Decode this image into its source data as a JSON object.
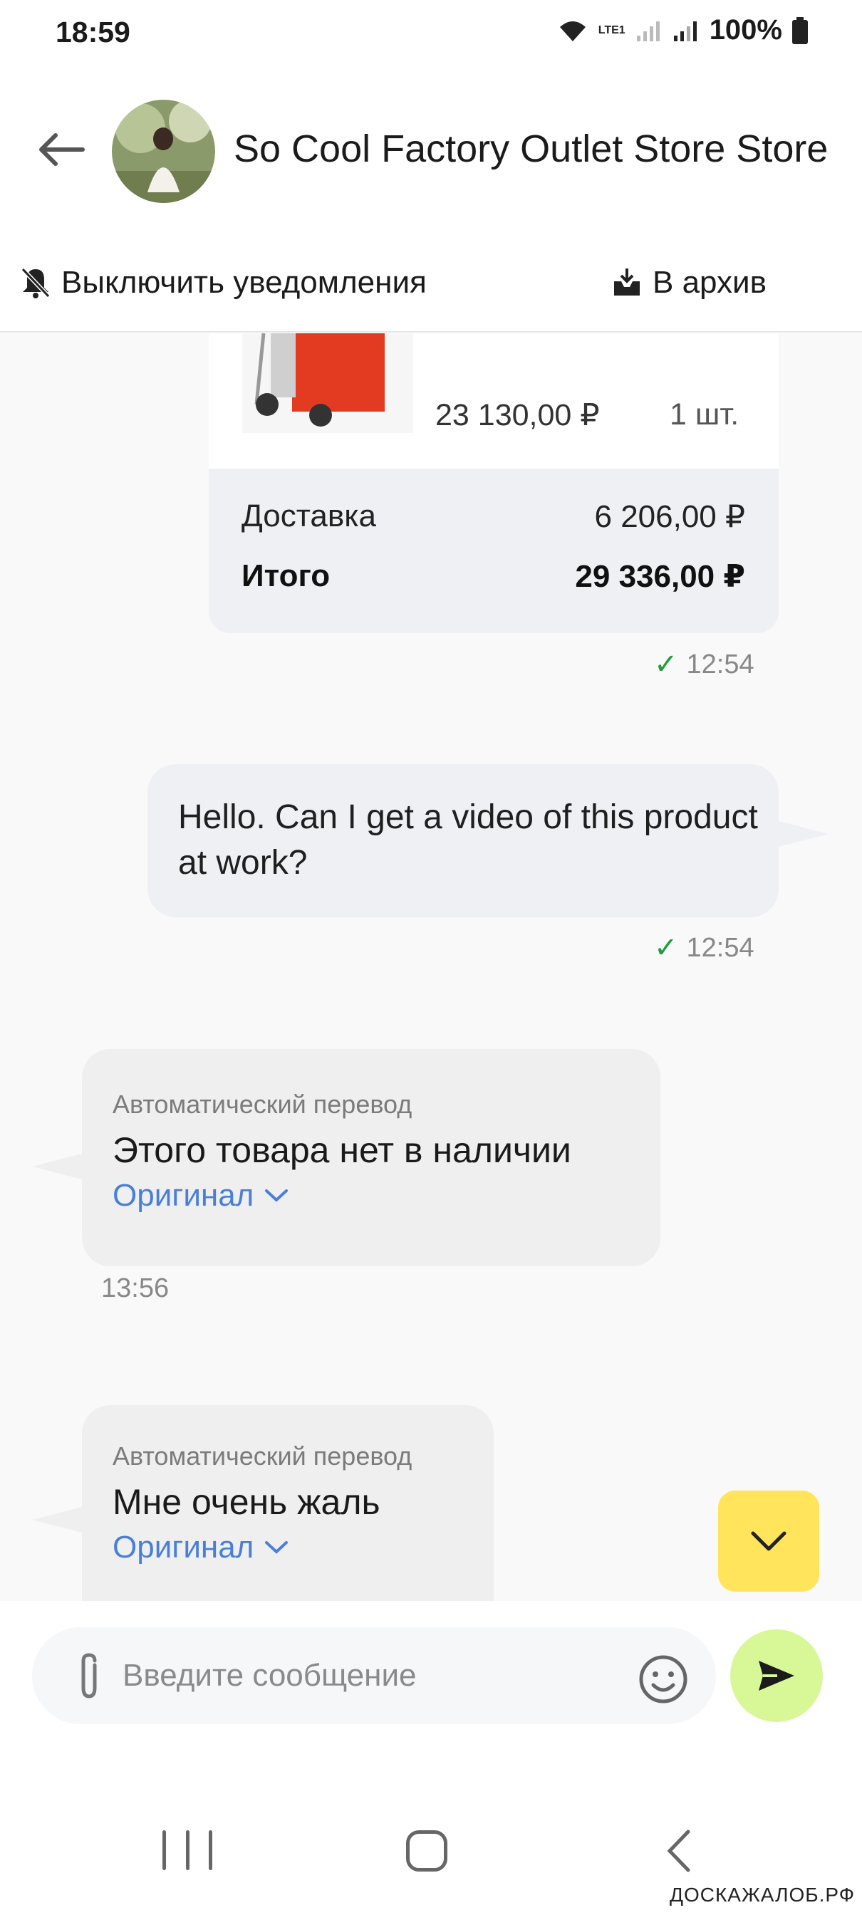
{
  "status_bar": {
    "time": "18:59",
    "battery": "100%",
    "network_label": "LTE1"
  },
  "header": {
    "back_icon": "arrow-left-icon",
    "store_name": "So Cool Factory Outlet Store Store",
    "mute_label": "Выключить уведомления",
    "archive_label": "В архив"
  },
  "order": {
    "price": "23 130,00 ₽",
    "quantity": "1 шт.",
    "delivery_label": "Доставка",
    "delivery_value": "6 206,00 ₽",
    "total_label": "Итого",
    "total_value": "29 336,00 ₽",
    "time": "12:54"
  },
  "messages": [
    {
      "direction": "out",
      "text": "Hello. Can I get a video of this product at work?",
      "time": "12:54"
    },
    {
      "direction": "in",
      "caption": "Автоматический перевод",
      "text": "Этого товара нет в наличии",
      "link": "Оригинал",
      "time": "13:56"
    },
    {
      "direction": "in",
      "caption": "Автоматический перевод",
      "text": "Мне очень жаль",
      "link": "Оригинал"
    }
  ],
  "composer": {
    "placeholder": "Введите сообщение"
  },
  "watermark": "ДОСКАЖАЛОБ.РФ",
  "colors": {
    "accent_blue": "#4a7fd8",
    "send_green": "#d8f797",
    "scroll_yellow": "#ffe45c",
    "check_green": "#1f9c3b"
  }
}
